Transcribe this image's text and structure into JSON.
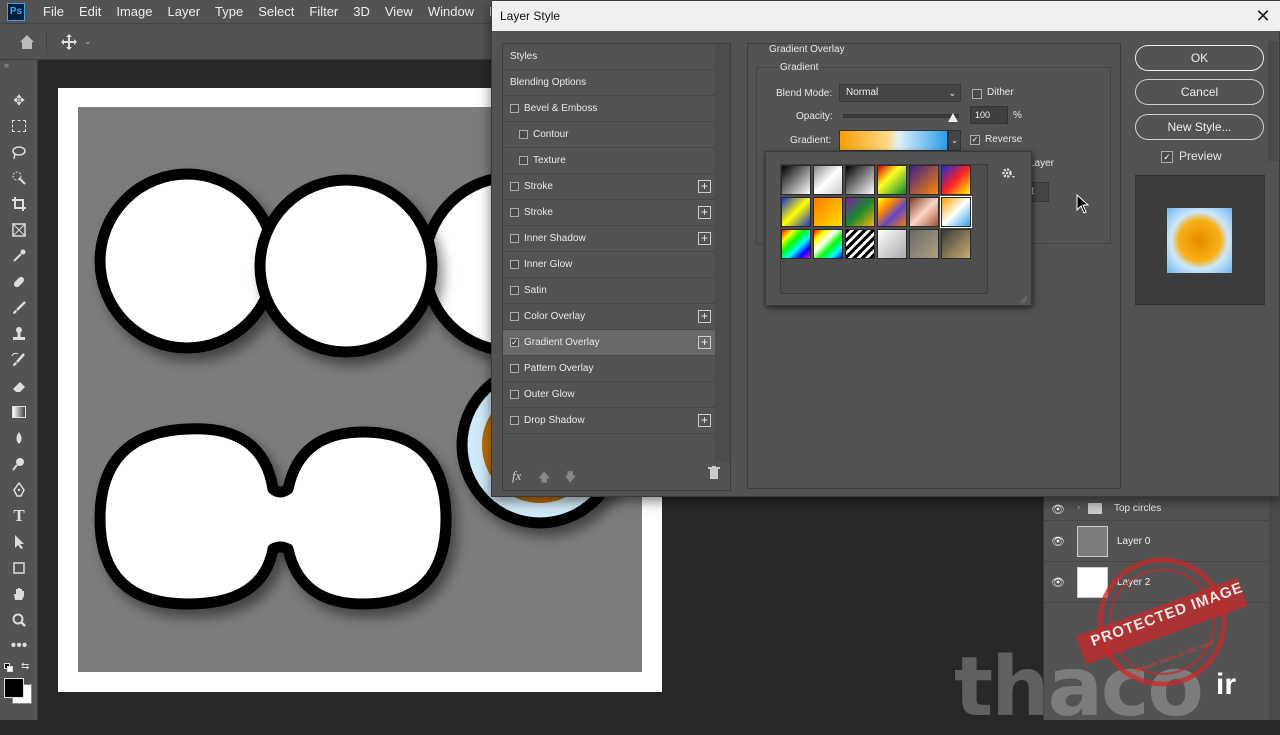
{
  "app": {
    "logo": "Ps"
  },
  "menu": [
    "File",
    "Edit",
    "Image",
    "Layer",
    "Type",
    "Select",
    "Filter",
    "3D",
    "View",
    "Window",
    "Help"
  ],
  "dialog": {
    "title": "Layer Style",
    "close_icon": "close-icon",
    "styles": [
      {
        "label": "Styles",
        "type": "header",
        "checked": false,
        "plus": false
      },
      {
        "label": "Blending Options",
        "type": "header",
        "checked": false,
        "plus": false
      },
      {
        "label": "Bevel & Emboss",
        "type": "item",
        "checked": false,
        "plus": false
      },
      {
        "label": "Contour",
        "type": "sub",
        "checked": false,
        "plus": false
      },
      {
        "label": "Texture",
        "type": "sub",
        "checked": false,
        "plus": false
      },
      {
        "label": "Stroke",
        "type": "item",
        "checked": false,
        "plus": true
      },
      {
        "label": "Stroke",
        "type": "item",
        "checked": false,
        "plus": true
      },
      {
        "label": "Inner Shadow",
        "type": "item",
        "checked": false,
        "plus": true
      },
      {
        "label": "Inner Glow",
        "type": "item",
        "checked": false,
        "plus": false
      },
      {
        "label": "Satin",
        "type": "item",
        "checked": false,
        "plus": false
      },
      {
        "label": "Color Overlay",
        "type": "item",
        "checked": false,
        "plus": true
      },
      {
        "label": "Gradient Overlay",
        "type": "item",
        "checked": true,
        "plus": true,
        "selected": true
      },
      {
        "label": "Pattern Overlay",
        "type": "item",
        "checked": false,
        "plus": false
      },
      {
        "label": "Outer Glow",
        "type": "item",
        "checked": false,
        "plus": false
      },
      {
        "label": "Drop Shadow",
        "type": "item",
        "checked": false,
        "plus": true
      }
    ],
    "fx_label": "fx",
    "settings": {
      "section_title": "Gradient Overlay",
      "group_title": "Gradient",
      "blend_mode_label": "Blend Mode:",
      "blend_mode_value": "Normal",
      "dither_label": "Dither",
      "dither_checked": false,
      "opacity_label": "Opacity:",
      "opacity_value": "100",
      "opacity_unit": "%",
      "gradient_label": "Gradient:",
      "reverse_label": "Reverse",
      "reverse_checked": true,
      "partial_layer_text": "Layer",
      "partial_t_text": "t"
    },
    "buttons": {
      "ok": "OK",
      "cancel": "Cancel",
      "new_style": "New Style...",
      "preview": "Preview"
    },
    "preview_checked": true
  },
  "gradient_swatches": [
    [
      "linear-gradient(135deg,#000 0%,#fff 100%)",
      "linear-gradient(135deg,#888 0%,#fff 50%,#ccc 100%)",
      "linear-gradient(135deg,#000 0%,#fff 100%)",
      "linear-gradient(135deg,#d00 0%,#ff2 40%,#083 100%)",
      "linear-gradient(135deg,#3a1e8a 0%,#f80 100%)",
      "linear-gradient(135deg,#1a2ad8 0%,#f22 50%,#ff0 100%)"
    ],
    [
      "linear-gradient(135deg,#1a30d0 0%,#ff0 50%,#1a30d0 100%)",
      "linear-gradient(135deg,#ff7a00 0%,#ffe000 100%)",
      "linear-gradient(135deg,#7b1fa2 0%,#198a2e 50%,#ffb400 100%)",
      "linear-gradient(135deg,#ff0 0%,#f80 30%,#6048c8 60%,#ff7a00 100%)",
      "linear-gradient(135deg,#7a3a28 0%,#ffd8c8 50%,#a05030 100%)",
      "linear-gradient(135deg,#f8a000 0%,#fff 50%,#2aa0f0 100%)"
    ],
    [
      "linear-gradient(135deg,#f00 0%,#ff0 20%,#0f0 40%,#0ff 60%,#00f 80%,#f0f 100%)",
      "linear-gradient(135deg,#f00 0%,#ff0 20%,#fff 40%,#0f0 60%,#0ff 80%,#00f 100%)",
      "repeating-linear-gradient(135deg,#000 0px,#000 3px,#fff 3px,#fff 6px)",
      "linear-gradient(135deg,#fff 0%,#aaa 100%)",
      "linear-gradient(135deg,#6a6a6a 0%,#b0a080 100%)",
      "linear-gradient(135deg,#3a3a3a 0%,#c8b070 100%)"
    ]
  ],
  "gradient_bar": "linear-gradient(90deg,#f5a000 0%,#ffd98a 45%,#dff0fb 55%,#2a9de8 100%)",
  "layers": [
    {
      "name": "Top circles",
      "type": "group"
    },
    {
      "name": "Layer 0",
      "type": "layer"
    },
    {
      "name": "Layer 2",
      "type": "layer"
    }
  ],
  "watermark": {
    "text": "thaco",
    "suffix": "ir",
    "stamp_main": "PROTECTED IMAGE",
    "stamp_sub": "My Website Name & URL Here"
  }
}
